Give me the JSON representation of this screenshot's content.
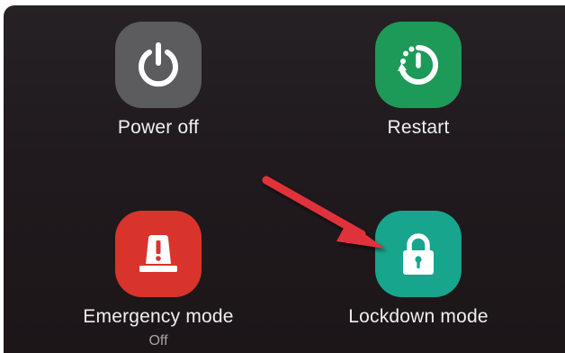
{
  "power_menu": {
    "items": [
      {
        "id": "power_off",
        "label": "Power off",
        "icon": "power-icon",
        "color": "#5c5b5e"
      },
      {
        "id": "restart",
        "label": "Restart",
        "icon": "restart-icon",
        "color": "#1d9a58"
      },
      {
        "id": "emergency_mode",
        "label": "Emergency mode",
        "status": "Off",
        "icon": "emergency-light-icon",
        "color": "#d8342c"
      },
      {
        "id": "lockdown_mode",
        "label": "Lockdown mode",
        "icon": "lock-icon",
        "color": "#17a58d"
      }
    ]
  },
  "annotation": {
    "icon": "red-arrow",
    "color": "#e0333a"
  }
}
